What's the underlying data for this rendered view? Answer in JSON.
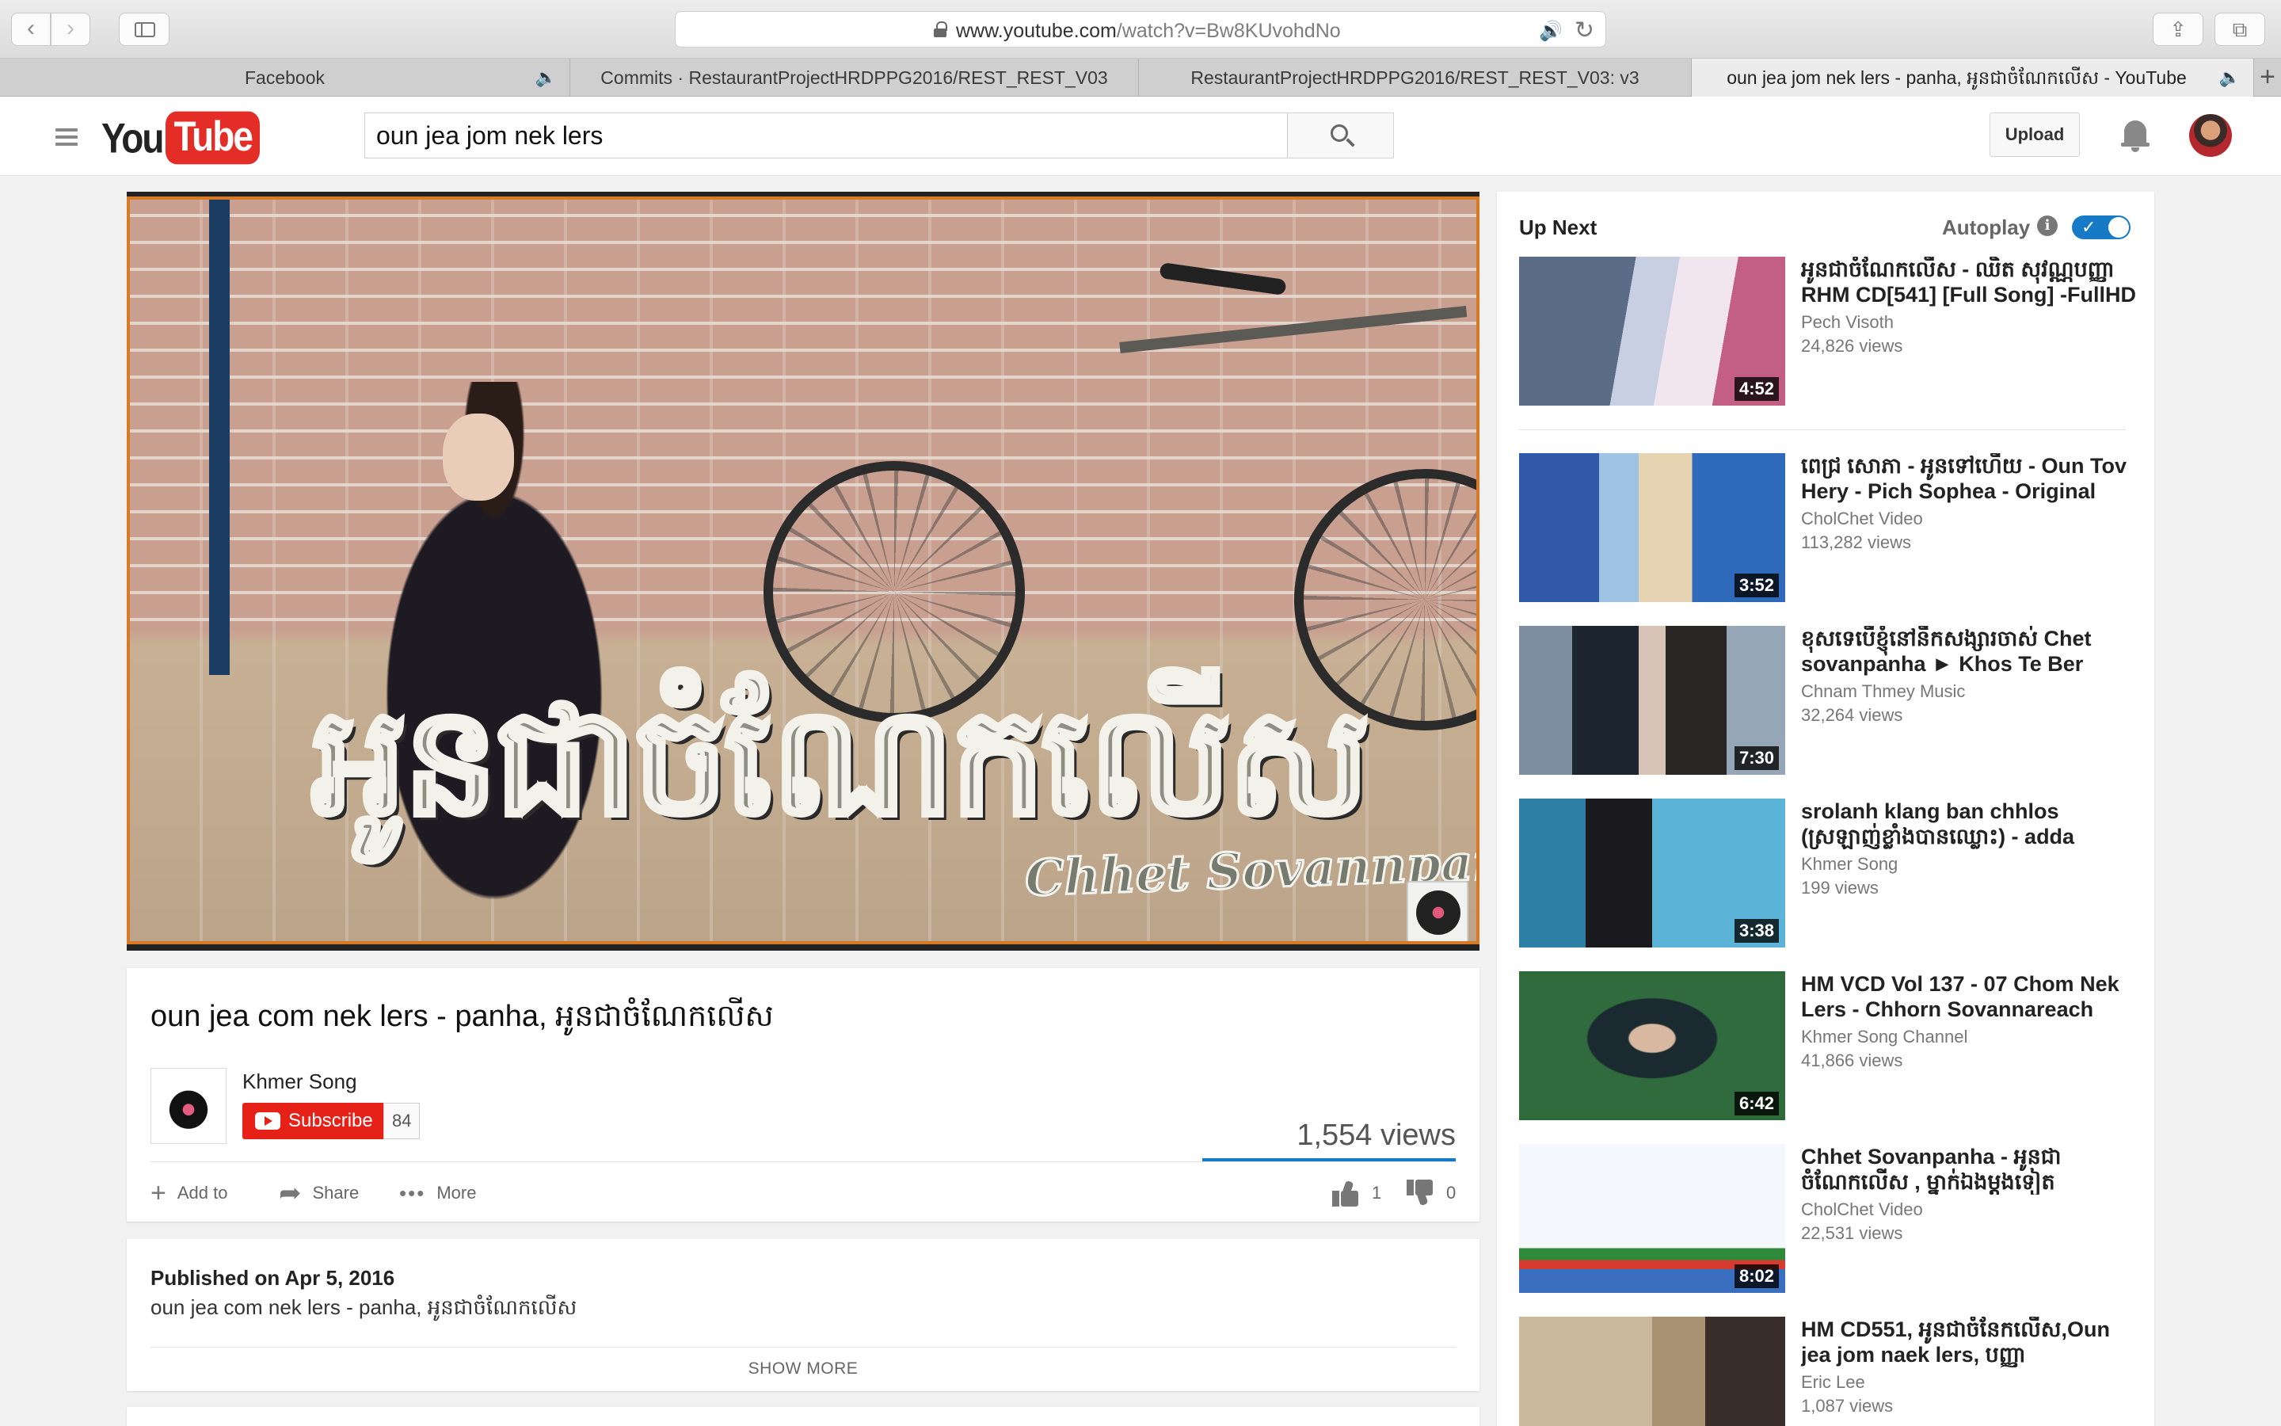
{
  "browser": {
    "url_host": "www.youtube.com",
    "url_path": "/watch?v=Bw8KUvohdNo",
    "tabs": [
      {
        "label": "Facebook"
      },
      {
        "label": "Commits · RestaurantProjectHRDPPG2016/REST_REST_V03"
      },
      {
        "label": "RestaurantProjectHRDPPG2016/REST_REST_V03: v3"
      },
      {
        "label": "oun jea jom nek lers - panha, អូនជាចំណែកលើស - YouTube"
      }
    ]
  },
  "header": {
    "logo_you": "You",
    "logo_tube": "Tube",
    "search_value": "oun jea jom nek lers",
    "upload_label": "Upload"
  },
  "player": {
    "overlay_title": "អូនជាចំណែកលើស",
    "overlay_artist": "Chhet Sovannpanha"
  },
  "video": {
    "title": "oun jea com nek lers - panha, អូនជាចំណែកលើស",
    "channel": "Khmer Song",
    "subscribe_label": "Subscribe",
    "subscriber_count": "84",
    "views": "1,554 views",
    "add_to_label": "Add to",
    "share_label": "Share",
    "more_label": "More",
    "likes": "1",
    "dislikes": "0",
    "published": "Published on Apr 5, 2016",
    "description": "oun jea com nek lers - panha, អូនជាចំណែកលើស",
    "show_more": "SHOW MORE"
  },
  "sidebar": {
    "up_next": "Up Next",
    "autoplay": "Autoplay",
    "autoplay_on": true,
    "videos": [
      {
        "title": "អូនជាចំណែកលើស - ឈិត សុវណ្ណបញ្ញា RHM CD[541] [Full Song] -FullHD",
        "channel": "Pech Visoth",
        "views": "24,826 views",
        "duration": "4:52"
      },
      {
        "title": "ពេជ្រ សោភា - អូនទៅហើយ - Oun Tov Hery - Pich Sophea - Original",
        "channel": "CholChet Video",
        "views": "113,282 views",
        "duration": "3:52"
      },
      {
        "title": "ខុសទេបើខ្ញុំនៅនឹកសង្សារចាស់ Chet sovanpanha ► Khos Te Ber",
        "channel": "Chnam Thmey Music",
        "views": "32,264 views",
        "duration": "7:30"
      },
      {
        "title": "srolanh klang ban chhlos (ស្រឡាញ់ខ្លាំងបានឈ្លោះ) - adda",
        "channel": "Khmer Song",
        "views": "199 views",
        "duration": "3:38"
      },
      {
        "title": "HM VCD Vol 137 - 07 Chom Nek Lers - Chhorn Sovannareach",
        "channel": "Khmer Song Channel",
        "views": "41,866 views",
        "duration": "6:42"
      },
      {
        "title": "Chhet Sovanpanha - អូនជាចំណែកលើស , ម្នាក់ឯងម្តងទៀត",
        "channel": "CholChet Video",
        "views": "22,531 views",
        "duration": "8:02"
      },
      {
        "title": "HM CD551, អូនជាចំនែកលើស,Oun jea jom naek lers, បញ្ញា",
        "channel": "Eric Lee",
        "views": "1,087 views",
        "duration": ""
      }
    ]
  },
  "colors": {
    "youtube_red": "#e52d27",
    "subscribe_red": "#e62117",
    "accent_blue": "#167ac6",
    "player_border": "#d87a25"
  }
}
